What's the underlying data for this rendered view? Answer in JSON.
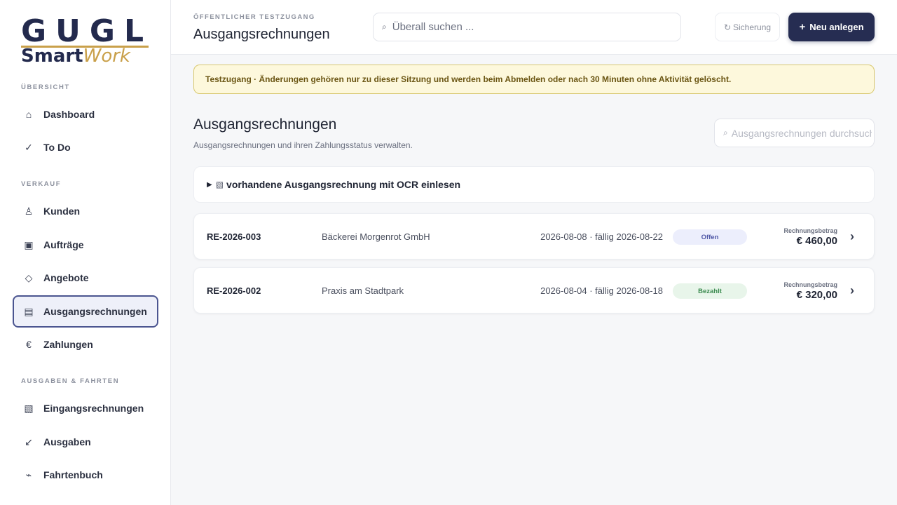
{
  "brand": {
    "top": "GUGL",
    "smart": "Smart",
    "work": "Work"
  },
  "sidebar": {
    "sections": [
      {
        "label": "ÜBERSICHT"
      },
      {
        "label": "VERKAUF"
      },
      {
        "label": "AUSGABEN & FAHRTEN"
      }
    ],
    "items": [
      {
        "label": "Dashboard",
        "icon": "⌂"
      },
      {
        "label": "To Do",
        "icon": "✓"
      },
      {
        "label": "Kunden",
        "icon": "♙"
      },
      {
        "label": "Aufträge",
        "icon": "▣"
      },
      {
        "label": "Angebote",
        "icon": "◇"
      },
      {
        "label": "Ausgangsrechnungen",
        "icon": "▤",
        "active": true
      },
      {
        "label": "Zahlungen",
        "icon": "€"
      },
      {
        "label": "Eingangsrechnungen",
        "icon": "▧"
      },
      {
        "label": "Ausgaben",
        "icon": "↙"
      },
      {
        "label": "Fahrtenbuch",
        "icon": "⌁"
      }
    ]
  },
  "header": {
    "eyebrow": "ÖFFENTLICHER TESTZUGANG",
    "title": "Ausgangsrechnungen",
    "search_icon": "⌕",
    "search_placeholder": "Überall suchen ...",
    "backup_icon": "↻",
    "backup_label": "Sicherung",
    "new_icon": "+",
    "new_label": "Neu anlegen"
  },
  "banner": {
    "text": "Testzugang · Änderungen gehören nur zu dieser Sitzung und werden beim Abmelden oder nach 30 Minuten ohne Aktivität gelöscht."
  },
  "main": {
    "title": "Ausgangsrechnungen",
    "subtitle": "Ausgangsrechnungen und ihren Zahlungsstatus verwalten.",
    "search_icon": "⌕",
    "search_placeholder": "Ausgangsrechnungen durchsuchen",
    "ocr": {
      "caret": "▶",
      "icon": "▧",
      "label": "vorhandene Ausgangsrechnung mit OCR einlesen"
    },
    "invoices": [
      {
        "number": "RE-2026-003",
        "customer": "Bäckerei Morgenrot GmbH",
        "dates": "2026-08-08 · fällig 2026-08-22",
        "status": "Offen",
        "amount_label": "Rechnungsbetrag",
        "amount": "€ 460,00",
        "chevron": "›"
      },
      {
        "number": "RE-2026-002",
        "customer": "Praxis am Stadtpark",
        "dates": "2026-08-04 · fällig 2026-08-18",
        "status": "Bezahlt",
        "amount_label": "Rechnungsbetrag",
        "amount": "€ 320,00",
        "chevron": "›"
      }
    ]
  },
  "colors": {
    "primary": "#262d52",
    "accent_gold": "#c9a04a",
    "active_border": "#4b5590",
    "banner_bg": "#fdf8dc",
    "badge_open": "#eceefc",
    "badge_paid": "#e8f5ea"
  }
}
